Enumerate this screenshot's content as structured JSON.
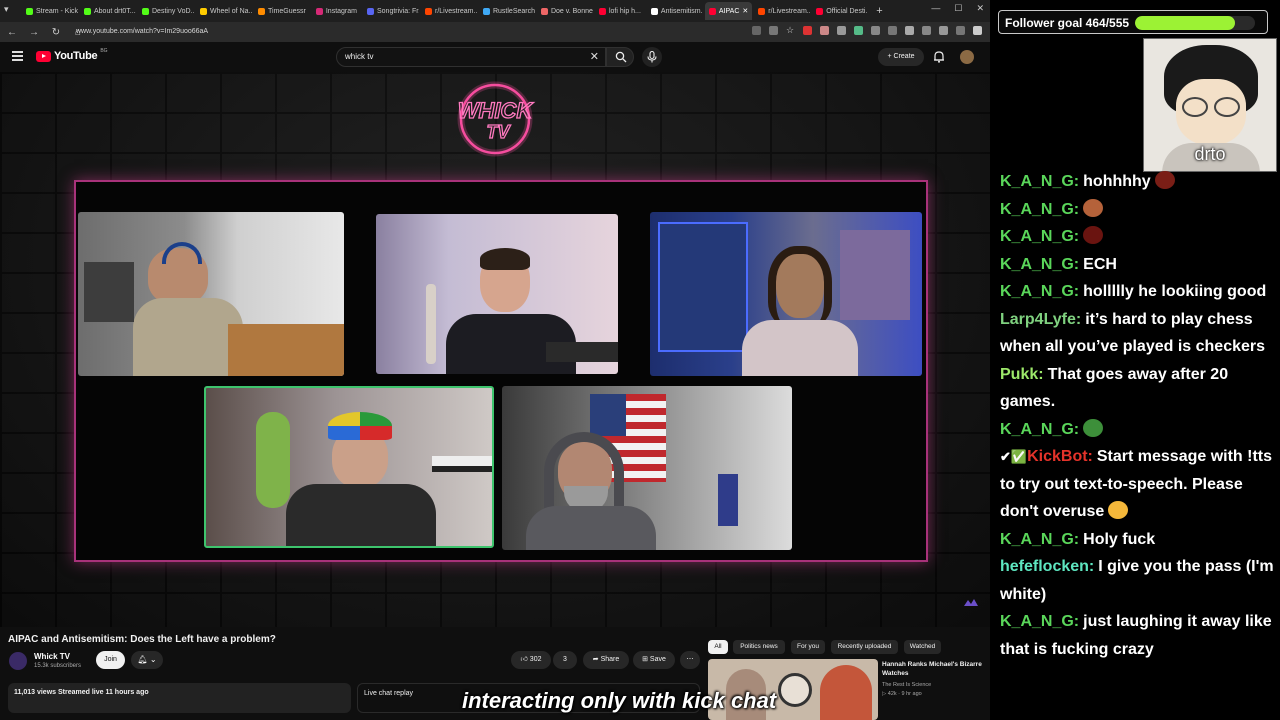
{
  "browser": {
    "tabs": [
      {
        "label": "Stream - Kick",
        "color": "#53fc18",
        "active": false
      },
      {
        "label": "About drt0T...",
        "color": "#53fc18",
        "active": false
      },
      {
        "label": "Destiny VoD...",
        "color": "#53fc18",
        "active": false
      },
      {
        "label": "Wheel of Na...",
        "color": "#ffcc00",
        "active": false
      },
      {
        "label": "TimeGuessr",
        "color": "#ff8c00",
        "active": false
      },
      {
        "label": "Instagram",
        "color": "#d62976",
        "active": false
      },
      {
        "label": "Songtrivia: Fr...",
        "color": "#5865f2",
        "active": false
      },
      {
        "label": "r/Livestream...",
        "color": "#ff4500",
        "active": false
      },
      {
        "label": "RustleSearch",
        "color": "#3fa9f5",
        "active": false
      },
      {
        "label": "Doe v. Bonne...",
        "color": "#e66",
        "active": false
      },
      {
        "label": "lofi hip h...",
        "color": "#ff0033",
        "active": false
      },
      {
        "label": "Antisemitism...",
        "color": "#fff",
        "active": false
      },
      {
        "label": "AIPAC",
        "color": "#ff0033",
        "active": true
      },
      {
        "label": "r/Livestream...",
        "color": "#ff4500",
        "active": false
      },
      {
        "label": "Official Desti...",
        "color": "#ff0033",
        "active": false
      }
    ],
    "url": "www.youtube.com/watch?v=Im29uoo66aA"
  },
  "youtube": {
    "logo_text": "YouTube",
    "country_code": "BG",
    "search_query": "whick tv",
    "create_label": "Create"
  },
  "video": {
    "neon_logo_line1": "WHICK",
    "neon_logo_line2": "TV",
    "title": "AIPAC and Antisemitism: Does the Left have a problem?",
    "channel_name": "Whick TV",
    "subscribers": "15.3k subscribers",
    "join_label": "Join",
    "likes": "302",
    "comments": "3",
    "share_label": "Share",
    "save_label": "Save",
    "stats": "11,013 views  Streamed live 11 hours ago",
    "live_chat_replay": "Live chat replay"
  },
  "recommend": {
    "chips": [
      "All",
      "Politics news",
      "For you",
      "Recently uploaded",
      "Watched"
    ],
    "item": {
      "title": "Hannah Ranks Michael's Bizarre Watches",
      "channel": "The Rest Is Science",
      "meta": "▷ 42k · 9 hr ago"
    }
  },
  "caption": "interacting only with kick chat",
  "overlay": {
    "follower_goal_label": "Follower goal 464/555",
    "follower_goal_progress": 0.836,
    "webcam_name": "drto",
    "chat": [
      {
        "user": "K_A_N_G:",
        "color": "#5ad65a",
        "text": "hohhhhy",
        "emote": "#7a1e16"
      },
      {
        "user": "K_A_N_G:",
        "color": "#5ad65a",
        "text": "",
        "emote": "#b5623a"
      },
      {
        "user": "K_A_N_G:",
        "color": "#5ad65a",
        "text": "",
        "emote": "#6a1410"
      },
      {
        "user": "K_A_N_G:",
        "color": "#5ad65a",
        "text": "ECH",
        "emote": ""
      },
      {
        "user": "K_A_N_G:",
        "color": "#5ad65a",
        "text": "hollllly he lookiing good",
        "emote": ""
      },
      {
        "user": "Larp4Lyfe:",
        "color": "#7fd17f",
        "text": "it’s hard to play chess when all you’ve played is checkers",
        "emote": ""
      },
      {
        "user": "Pukk:",
        "color": "#9de86a",
        "text": "That goes away after 20 games.",
        "emote": ""
      },
      {
        "user": "K_A_N_G:",
        "color": "#5ad65a",
        "text": "",
        "emote": "#3d8f3a"
      },
      {
        "user": "KickBot:",
        "color": "#e5332a",
        "text": "Start message with !tts to try out text-to-speech. Please don't overuse",
        "emote": "#f5b83a",
        "badges": "✔✅"
      },
      {
        "user": "K_A_N_G:",
        "color": "#5ad65a",
        "text": "Holy fuck",
        "emote": ""
      },
      {
        "user": "hefeflocken:",
        "color": "#5ee6c0",
        "text": "I give you the pass (I'm white)",
        "emote": ""
      },
      {
        "user": "K_A_N_G:",
        "color": "#5ad65a",
        "text": "just laughing it away like that is fucking crazy",
        "emote": ""
      }
    ]
  }
}
